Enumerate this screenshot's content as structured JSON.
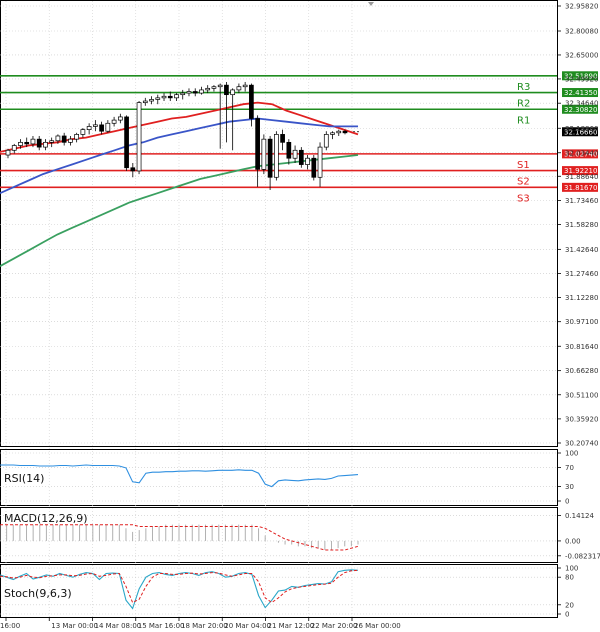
{
  "chart_data": {
    "type": "candlestick",
    "price_axis": {
      "ticks": [
        "32.95820",
        "32.80080",
        "32.65000",
        "32.49920",
        "32.34640",
        "32.18860",
        "32.03440",
        "31.88640",
        "31.73460",
        "31.58280",
        "31.42640",
        "31.27460",
        "31.12280",
        "30.97100",
        "30.81640",
        "30.66280",
        "30.51100",
        "30.35920",
        "30.20740"
      ],
      "range": [
        30.2074,
        32.9582
      ]
    },
    "x_ticks": [
      "16:00",
      "13 Mar 00:00",
      "14 Mar 08:00",
      "15 Mar 16:00",
      "18 Mar 20:00",
      "20 Mar 04:00",
      "21 Mar 12:00",
      "22 Mar 20:00",
      "26 Mar 00:00"
    ],
    "pivot_levels": [
      {
        "name": "R3",
        "value": "32.51890",
        "color": "#1f8c1f"
      },
      {
        "name": "R2",
        "value": "32.41350",
        "color": "#1f8c1f"
      },
      {
        "name": "R1",
        "value": "32.30820",
        "color": "#1f8c1f"
      },
      {
        "name": "S1",
        "value": "32.02740",
        "color": "#e02020"
      },
      {
        "name": "S2",
        "value": "31.92210",
        "color": "#e02020"
      },
      {
        "name": "S3",
        "value": "31.81670",
        "color": "#e02020"
      }
    ],
    "current_price": "32.16660",
    "candles": [
      [
        32.02,
        32.06,
        32.0,
        32.05
      ],
      [
        32.05,
        32.09,
        32.03,
        32.08
      ],
      [
        32.08,
        32.12,
        32.06,
        32.1
      ],
      [
        32.1,
        32.13,
        32.07,
        32.09
      ],
      [
        32.09,
        32.14,
        32.07,
        32.12
      ],
      [
        32.12,
        32.14,
        32.05,
        32.07
      ],
      [
        32.07,
        32.12,
        32.05,
        32.1
      ],
      [
        32.1,
        32.13,
        32.07,
        32.11
      ],
      [
        32.11,
        32.15,
        32.09,
        32.14
      ],
      [
        32.14,
        32.16,
        32.08,
        32.1
      ],
      [
        32.1,
        32.14,
        32.08,
        32.12
      ],
      [
        32.12,
        32.16,
        32.1,
        32.15
      ],
      [
        32.15,
        32.19,
        32.13,
        32.18
      ],
      [
        32.18,
        32.22,
        32.15,
        32.2
      ],
      [
        32.2,
        32.24,
        32.17,
        32.21
      ],
      [
        32.21,
        32.23,
        32.15,
        32.17
      ],
      [
        32.17,
        32.24,
        32.16,
        32.22
      ],
      [
        32.22,
        32.26,
        32.2,
        32.24
      ],
      [
        32.24,
        32.28,
        32.22,
        32.26
      ],
      [
        32.26,
        32.27,
        31.92,
        31.94
      ],
      [
        31.94,
        31.97,
        31.88,
        31.92
      ],
      [
        31.92,
        32.36,
        31.9,
        32.35
      ],
      [
        32.35,
        32.38,
        32.33,
        32.36
      ],
      [
        32.36,
        32.39,
        32.34,
        32.37
      ],
      [
        32.37,
        32.4,
        32.34,
        32.38
      ],
      [
        32.38,
        32.41,
        32.36,
        32.39
      ],
      [
        32.39,
        32.42,
        32.36,
        32.38
      ],
      [
        32.38,
        32.41,
        32.36,
        32.4
      ],
      [
        32.4,
        32.43,
        32.37,
        32.41
      ],
      [
        32.41,
        32.44,
        32.39,
        32.42
      ],
      [
        32.42,
        32.44,
        32.39,
        32.41
      ],
      [
        32.41,
        32.45,
        32.4,
        32.43
      ],
      [
        32.43,
        32.46,
        32.41,
        32.44
      ],
      [
        32.44,
        32.46,
        32.42,
        32.45
      ],
      [
        32.45,
        32.47,
        32.06,
        32.46
      ],
      [
        32.46,
        32.48,
        32.1,
        32.4
      ],
      [
        32.4,
        32.44,
        32.05,
        32.43
      ],
      [
        32.43,
        32.47,
        32.41,
        32.45
      ],
      [
        32.45,
        32.48,
        32.42,
        32.46
      ],
      [
        32.46,
        32.47,
        32.2,
        32.25
      ],
      [
        32.25,
        32.27,
        31.82,
        31.93
      ],
      [
        31.93,
        32.15,
        31.9,
        32.12
      ],
      [
        32.12,
        32.14,
        31.8,
        31.88
      ],
      [
        31.88,
        32.17,
        31.86,
        32.15
      ],
      [
        32.15,
        32.18,
        32.05,
        32.1
      ],
      [
        32.1,
        32.12,
        31.96,
        32.0
      ],
      [
        32.0,
        32.08,
        31.97,
        32.05
      ],
      [
        32.05,
        32.07,
        31.94,
        31.96
      ],
      [
        31.96,
        32.02,
        31.93,
        32.0
      ],
      [
        32.0,
        32.02,
        31.86,
        31.88
      ],
      [
        31.88,
        32.1,
        31.82,
        32.07
      ],
      [
        32.07,
        32.17,
        32.05,
        32.15
      ],
      [
        32.15,
        32.17,
        32.12,
        32.16
      ],
      [
        32.16,
        32.18,
        32.14,
        32.17
      ],
      [
        32.17,
        32.18,
        32.15,
        32.16
      ]
    ],
    "moving_averages": [
      {
        "color": "#e02020",
        "values": [
          32.04,
          32.06,
          32.08,
          32.09,
          32.1,
          32.12,
          32.13,
          32.15,
          32.17,
          32.19,
          32.21,
          32.23,
          32.25,
          32.26,
          32.28,
          32.3,
          32.32,
          32.34,
          32.35,
          32.34,
          32.3,
          32.27,
          32.24,
          32.21,
          32.18,
          32.15
        ]
      },
      {
        "color": "#3a55c8",
        "values": [
          31.78,
          31.82,
          31.86,
          31.9,
          31.93,
          31.96,
          31.99,
          32.02,
          32.05,
          32.08,
          32.1,
          32.13,
          32.15,
          32.17,
          32.19,
          32.21,
          32.23,
          32.24,
          32.25,
          32.24,
          32.23,
          32.22,
          32.21,
          32.2,
          32.2,
          32.2
        ]
      },
      {
        "color": "#3aa060",
        "values": [
          31.32,
          31.37,
          31.42,
          31.47,
          31.52,
          31.56,
          31.6,
          31.64,
          31.68,
          31.72,
          31.75,
          31.78,
          31.81,
          31.84,
          31.87,
          31.89,
          31.91,
          31.93,
          31.95,
          31.96,
          31.97,
          31.98,
          31.99,
          32.0,
          32.01,
          32.02
        ]
      }
    ],
    "indicators": [
      {
        "name": "RSI(14)",
        "ticks": [
          "100",
          "70",
          "30",
          "0"
        ],
        "range": [
          0,
          100
        ],
        "values": [
          75,
          75,
          75,
          74,
          74,
          74,
          73,
          73,
          73,
          74,
          74,
          73,
          74,
          75,
          74,
          74,
          74,
          74,
          73,
          69,
          40,
          38,
          58,
          60,
          60,
          61,
          61,
          62,
          62,
          63,
          63,
          62,
          63,
          64,
          64,
          64,
          65,
          64,
          64,
          58,
          35,
          30,
          42,
          44,
          43,
          42,
          44,
          45,
          46,
          45,
          47,
          52,
          53,
          54,
          55
        ]
      },
      {
        "name": "MACD(12,26,9)",
        "ticks": [
          "0.14124",
          "0.00",
          "-0.082317"
        ],
        "range": [
          -0.1,
          0.16
        ],
        "histogram": [
          0.09,
          0.09,
          0.09,
          0.09,
          0.09,
          0.09,
          0.09,
          0.09,
          0.09,
          0.09,
          0.09,
          0.09,
          0.09,
          0.09,
          0.09,
          0.09,
          0.09,
          0.09,
          0.09,
          0.07,
          0.05,
          0.06,
          0.07,
          0.08,
          0.08,
          0.09,
          0.09,
          0.09,
          0.09,
          0.09,
          0.09,
          0.09,
          0.09,
          0.09,
          0.09,
          0.09,
          0.09,
          0.09,
          0.09,
          0.07,
          0.03,
          0.0,
          -0.01,
          -0.02,
          -0.02,
          -0.03,
          -0.03,
          -0.04,
          -0.04,
          -0.05,
          -0.05,
          -0.04,
          -0.03,
          -0.03,
          -0.02
        ],
        "signal": [
          0.09,
          0.09,
          0.09,
          0.09,
          0.09,
          0.09,
          0.09,
          0.09,
          0.09,
          0.09,
          0.09,
          0.09,
          0.09,
          0.09,
          0.09,
          0.09,
          0.09,
          0.09,
          0.09,
          0.09,
          0.09,
          0.08,
          0.08,
          0.08,
          0.08,
          0.08,
          0.08,
          0.08,
          0.08,
          0.08,
          0.08,
          0.08,
          0.08,
          0.08,
          0.08,
          0.08,
          0.08,
          0.08,
          0.08,
          0.08,
          0.07,
          0.05,
          0.03,
          0.01,
          0.0,
          -0.01,
          -0.02,
          -0.03,
          -0.04,
          -0.05,
          -0.05,
          -0.05,
          -0.05,
          -0.04,
          -0.03
        ]
      },
      {
        "name": "Stoch(9,6,3)",
        "ticks": [
          "100",
          "80",
          "20",
          "0"
        ],
        "range": [
          0,
          100
        ],
        "k": [
          85,
          80,
          75,
          82,
          88,
          76,
          80,
          85,
          82,
          88,
          84,
          80,
          86,
          90,
          88,
          75,
          88,
          89,
          88,
          30,
          12,
          55,
          80,
          88,
          90,
          86,
          84,
          88,
          90,
          88,
          84,
          90,
          92,
          88,
          80,
          82,
          88,
          90,
          86,
          40,
          14,
          30,
          50,
          52,
          60,
          58,
          62,
          64,
          66,
          65,
          70,
          92,
          95,
          96,
          95
        ],
        "d": [
          82,
          81,
          78,
          80,
          84,
          80,
          79,
          82,
          83,
          85,
          85,
          83,
          84,
          87,
          88,
          82,
          84,
          87,
          88,
          60,
          25,
          32,
          60,
          80,
          88,
          88,
          86,
          86,
          88,
          89,
          87,
          88,
          90,
          89,
          85,
          82,
          85,
          88,
          88,
          70,
          35,
          25,
          35,
          48,
          55,
          58,
          60,
          62,
          64,
          65,
          67,
          80,
          90,
          94,
          95
        ]
      }
    ]
  }
}
